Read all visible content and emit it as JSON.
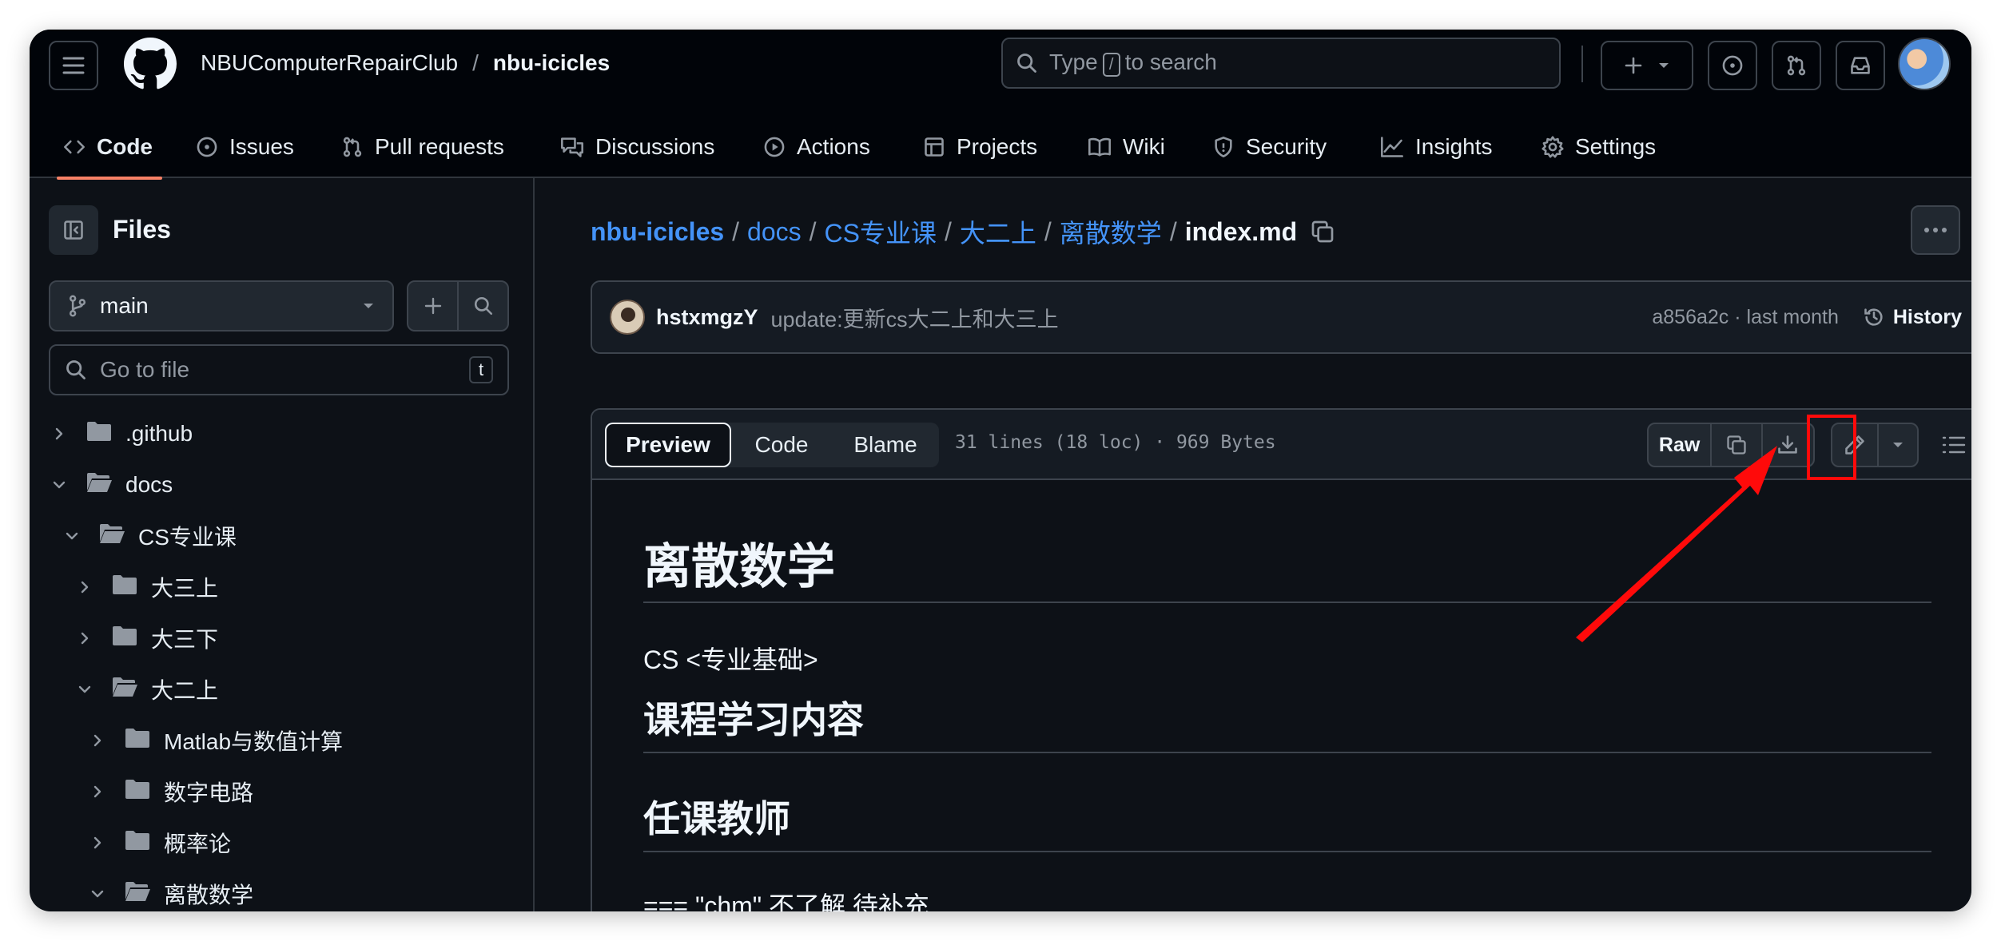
{
  "header": {
    "repo_owner": "NBUComputerRepairClub",
    "repo_separator": "/",
    "repo_name": "nbu-icicles",
    "search_prefix": "Type",
    "search_key": "/",
    "search_suffix": "to search"
  },
  "tabs": [
    {
      "label": "Code",
      "icon": "code-icon",
      "active": true
    },
    {
      "label": "Issues",
      "icon": "issue-opened-icon"
    },
    {
      "label": "Pull requests",
      "icon": "git-pull-request-icon"
    },
    {
      "label": "Discussions",
      "icon": "comment-discussion-icon"
    },
    {
      "label": "Actions",
      "icon": "play-icon"
    },
    {
      "label": "Projects",
      "icon": "table-icon"
    },
    {
      "label": "Wiki",
      "icon": "book-icon"
    },
    {
      "label": "Security",
      "icon": "shield-icon"
    },
    {
      "label": "Insights",
      "icon": "graph-icon"
    },
    {
      "label": "Settings",
      "icon": "gear-icon"
    }
  ],
  "sidebar": {
    "title": "Files",
    "branch": "main",
    "goto_placeholder": "Go to file",
    "goto_shortcut": "t",
    "tree": [
      {
        "label": ".github",
        "expanded": false
      },
      {
        "label": "docs",
        "expanded": true
      },
      {
        "label": "CS专业课",
        "expanded": true
      },
      {
        "label": "大三上",
        "expanded": false
      },
      {
        "label": "大三下",
        "expanded": false
      },
      {
        "label": "大二上",
        "expanded": true
      },
      {
        "label": "Matlab与数值计算",
        "expanded": false
      },
      {
        "label": "数字电路",
        "expanded": false
      },
      {
        "label": "概率论",
        "expanded": false
      },
      {
        "label": "离散数学",
        "expanded": true
      }
    ]
  },
  "breadcrumb": {
    "repo": "nbu-icicles",
    "sep": "/",
    "parts": [
      "docs",
      "CS专业课",
      "大二上",
      "离散数学"
    ],
    "file": "index.md"
  },
  "commit": {
    "author": "hstxmgzY",
    "message": "update:更新cs大二上和大三上",
    "meta": "a856a2c · last month",
    "history_label": "History"
  },
  "file": {
    "view_tabs": [
      "Preview",
      "Code",
      "Blame"
    ],
    "meta": "31 lines (18 loc) · 969 Bytes",
    "raw_label": "Raw"
  },
  "markdown": {
    "h1": "离散数学",
    "p1": "CS <专业基础>",
    "h2a": "课程学习内容",
    "h2b": "任课教师",
    "p2": "=== \"chm\" 不了解 待补充"
  },
  "annotation": {
    "highlight_color": "#ff0a0a"
  },
  "colors": {
    "accent_link": "#4493f8",
    "tab_underline": "#f78166",
    "bg": "#0d1117",
    "header_bg": "#010409"
  }
}
